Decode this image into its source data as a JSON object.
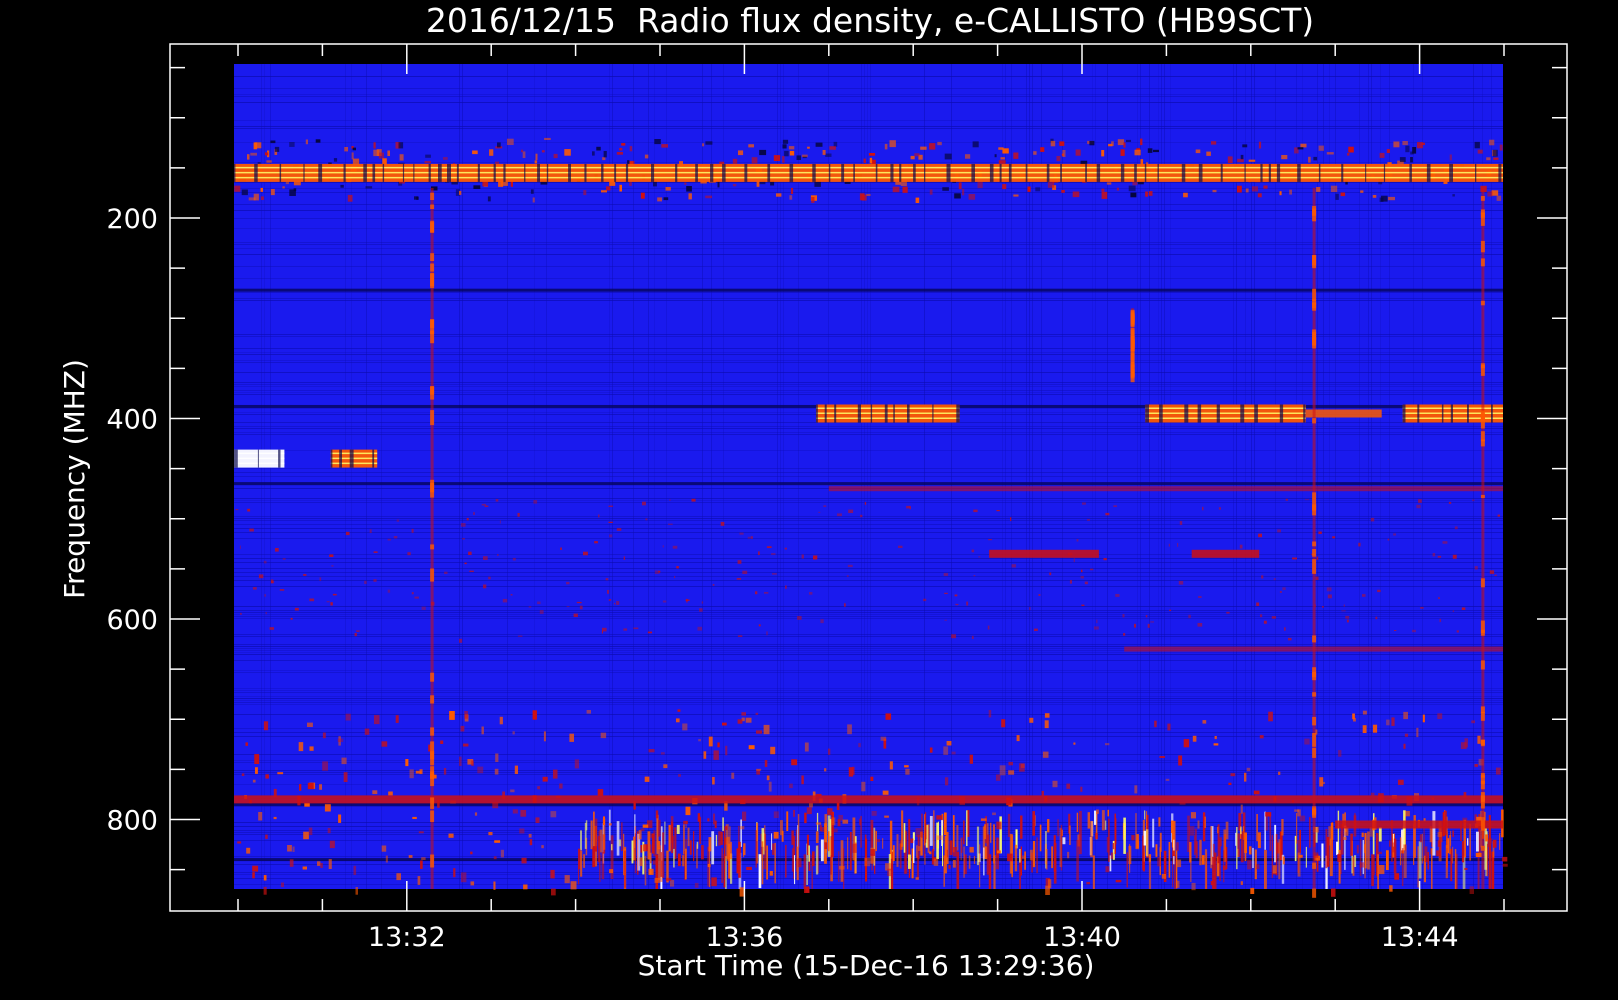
{
  "chart_data": {
    "type": "heatmap",
    "title": "2016/12/15  Radio flux density, e-CALLISTO (HB9SCT)",
    "xlabel": "Start Time (15-Dec-16 13:29:36)",
    "ylabel": "Frequency (MHZ)",
    "x_ticks": [
      "13:32",
      "13:36",
      "13:40",
      "13:44"
    ],
    "x_tick_minutes": [
      32,
      36,
      40,
      44
    ],
    "x_range_minutes": [
      29.6,
      45.0
    ],
    "y_ticks": [
      200,
      400,
      600,
      800
    ],
    "y_range": [
      45,
      870
    ],
    "y_inverted": true,
    "colors": {
      "background": "#1a1aee",
      "grain_dark": "#0c0cb0",
      "signal_red": "#d01010",
      "signal_orange": "#ff5a00",
      "signal_yellow": "#ffff6a",
      "signal_white": "#ffffff",
      "axes": "#ffffff"
    },
    "horizontal_bands": [
      {
        "freq": 155,
        "t0": 29.6,
        "t1": 45.0,
        "color": "orange",
        "intensity": "high"
      },
      {
        "freq": 395,
        "t0": 36.85,
        "t1": 38.55,
        "color": "orange",
        "intensity": "high"
      },
      {
        "freq": 395,
        "t0": 40.75,
        "t1": 42.65,
        "color": "orange",
        "intensity": "high"
      },
      {
        "freq": 395,
        "t0": 42.65,
        "t1": 43.55,
        "color": "orange",
        "intensity": "medium"
      },
      {
        "freq": 395,
        "t0": 43.8,
        "t1": 45.0,
        "color": "orange",
        "intensity": "high"
      },
      {
        "freq": 440,
        "t0": 29.7,
        "t1": 30.55,
        "color": "white",
        "intensity": "high"
      },
      {
        "freq": 440,
        "t0": 31.1,
        "t1": 31.65,
        "color": "orange",
        "intensity": "high"
      },
      {
        "freq": 535,
        "t0": 38.9,
        "t1": 40.2,
        "color": "red",
        "intensity": "medium"
      },
      {
        "freq": 535,
        "t0": 41.3,
        "t1": 42.1,
        "color": "red",
        "intensity": "medium"
      },
      {
        "freq": 470,
        "t0": 37.0,
        "t1": 45.0,
        "color": "red",
        "intensity": "low"
      },
      {
        "freq": 630,
        "t0": 40.5,
        "t1": 45.0,
        "color": "red",
        "intensity": "low"
      },
      {
        "freq": 780,
        "t0": 29.6,
        "t1": 45.0,
        "color": "red",
        "intensity": "medium"
      },
      {
        "freq": 805,
        "t0": 43.0,
        "t1": 45.0,
        "color": "red",
        "intensity": "medium"
      }
    ],
    "vertical_bursts": [
      {
        "t": 32.3,
        "f0": 170,
        "f1": 870
      },
      {
        "t": 42.75,
        "f0": 170,
        "f1": 870
      },
      {
        "t": 44.75,
        "f0": 170,
        "f1": 870
      },
      {
        "t": 40.6,
        "f0": 290,
        "f1": 360
      }
    ],
    "dark_lines": [
      {
        "freq": 272,
        "t0": 29.6,
        "t1": 45.0
      },
      {
        "freq": 388,
        "t0": 29.6,
        "t1": 45.0
      },
      {
        "freq": 465,
        "t0": 29.6,
        "t1": 45.0
      },
      {
        "freq": 785,
        "t0": 29.6,
        "t1": 45.0
      },
      {
        "freq": 840,
        "t0": 29.6,
        "t1": 45.0
      }
    ],
    "broadband_region": {
      "f0": 790,
      "f1": 870,
      "t0": 34.0,
      "t1": 45.0
    }
  }
}
